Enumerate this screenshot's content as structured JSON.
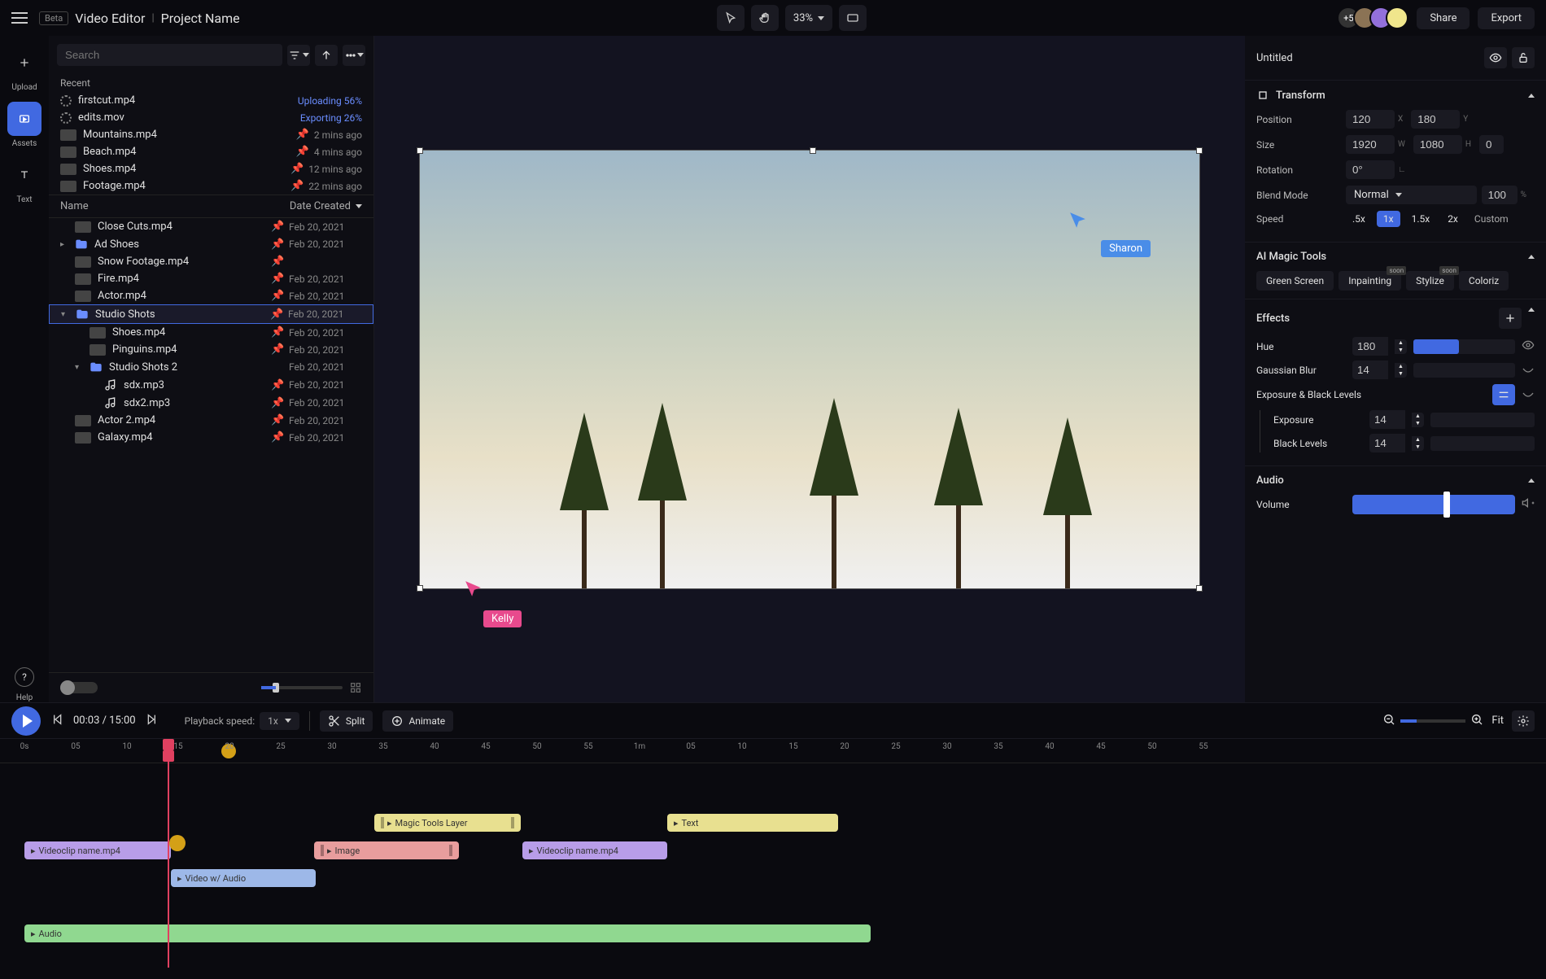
{
  "header": {
    "beta": "Beta",
    "app_name": "Video Editor",
    "project_name": "Project Name",
    "zoom": "33%",
    "avatar_count": "+5",
    "share": "Share",
    "export": "Export"
  },
  "left_rail": {
    "upload": "Upload",
    "assets": "Assets",
    "text": "Text",
    "help": "Help"
  },
  "assets": {
    "search_placeholder": "Search",
    "recent_title": "Recent",
    "name_col": "Name",
    "date_col": "Date Created",
    "recent": [
      {
        "name": "firstcut.mp4",
        "status": "Uploading 56%",
        "spinner": true
      },
      {
        "name": "edits.mov",
        "status": "Exporting 26%",
        "spinner": true
      },
      {
        "name": "Mountains.mp4",
        "meta": "2 mins ago",
        "pin": true
      },
      {
        "name": "Beach.mp4",
        "meta": "4 mins ago",
        "pin": true
      },
      {
        "name": "Shoes.mp4",
        "meta": "12 mins ago",
        "pin": true
      },
      {
        "name": "Footage.mp4",
        "meta": "22 mins ago",
        "pin": true
      }
    ],
    "files": [
      {
        "name": "Close Cuts.mp4",
        "date": "Feb 20, 2021",
        "pin": true
      },
      {
        "name": "Ad Shoes",
        "date": "Feb 20, 2021",
        "pin": true,
        "folder": true,
        "caret": "▸"
      },
      {
        "name": "Snow Footage.mp4",
        "date": "",
        "pin": true
      },
      {
        "name": "Fire.mp4",
        "date": "Feb 20, 2021",
        "pin": true
      },
      {
        "name": "Actor.mp4",
        "date": "Feb 20, 2021",
        "pin": true
      },
      {
        "name": "Studio Shots",
        "date": "Feb 20, 2021",
        "pin": true,
        "folder": true,
        "caret": "▾",
        "selected": true
      },
      {
        "name": "Shoes.mp4",
        "date": "Feb 20, 2021",
        "pin": true,
        "indent": 1
      },
      {
        "name": "Pinguins.mp4",
        "date": "Feb 20, 2021",
        "pin": true,
        "indent": 1
      },
      {
        "name": "Studio Shots 2",
        "date": "Feb 20, 2021",
        "folder": true,
        "caret": "▾",
        "indent": 1
      },
      {
        "name": "sdx.mp3",
        "date": "Feb 20, 2021",
        "pin": true,
        "indent": 2,
        "audio": true
      },
      {
        "name": "sdx2.mp3",
        "date": "Feb 20, 2021",
        "pin": true,
        "indent": 2,
        "audio": true
      },
      {
        "name": "Actor 2.mp4",
        "date": "Feb 20, 2021",
        "pin": true
      },
      {
        "name": "Galaxy.mp4",
        "date": "Feb 20, 2021",
        "pin": true
      }
    ]
  },
  "canvas": {
    "cursor1": "Sharon",
    "cursor2": "Kelly"
  },
  "inspector": {
    "title": "Untitled",
    "transform": {
      "title": "Transform",
      "position_label": "Position",
      "pos_x": "120",
      "pos_y": "180",
      "size_label": "Size",
      "size_w": "1920",
      "size_h": "1080",
      "size_extra": "0",
      "rotation_label": "Rotation",
      "rotation": "0°",
      "blend_label": "Blend Mode",
      "blend_value": "Normal",
      "blend_opacity": "100",
      "speed_label": "Speed",
      "speeds": [
        ".5x",
        "1x",
        "1.5x",
        "2x"
      ],
      "custom": "Custom"
    },
    "ai": {
      "title": "AI Magic Tools",
      "chips": [
        "Green Screen",
        "Inpainting",
        "Stylize",
        "Coloriz"
      ]
    },
    "effects": {
      "title": "Effects",
      "hue_label": "Hue",
      "hue_val": "180",
      "blur_label": "Gaussian Blur",
      "blur_val": "14",
      "exposure_group": "Exposure & Black Levels",
      "exposure_label": "Exposure",
      "exposure_val": "14",
      "black_label": "Black Levels",
      "black_val": "14"
    },
    "audio": {
      "title": "Audio",
      "volume_label": "Volume"
    }
  },
  "timeline": {
    "time": "00:03 / 15:00",
    "pb_label": "Playback speed:",
    "pb_value": "1x",
    "split": "Split",
    "animate": "Animate",
    "fit": "Fit",
    "ticks": [
      "0s",
      "05",
      "10",
      "15",
      "20",
      "25",
      "30",
      "35",
      "40",
      "45",
      "50",
      "55",
      "1m",
      "05",
      "10",
      "15",
      "20",
      "25",
      "30",
      "35",
      "40",
      "45",
      "50",
      "55"
    ],
    "clips": {
      "magic": "Magic Tools Layer",
      "text": "Text",
      "video1": "Videoclip name.mp4",
      "image": "Image",
      "video2": "Videoclip name.mp4",
      "videoaudio": "Video w/ Audio",
      "audio": "Audio"
    }
  }
}
